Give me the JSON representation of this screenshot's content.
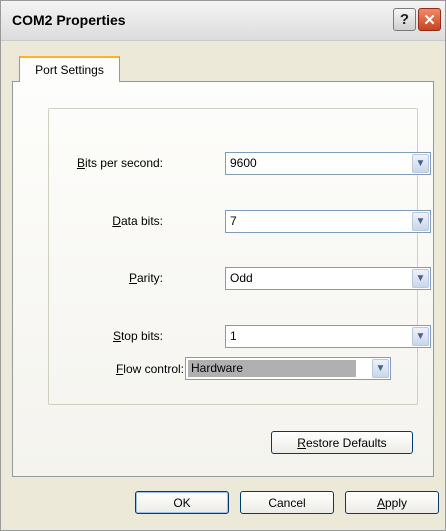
{
  "window": {
    "title": "COM2 Properties",
    "help_glyph": "?",
    "close_glyph": "✕"
  },
  "tabs": [
    {
      "label": "Port Settings",
      "active": true
    }
  ],
  "fields": [
    {
      "label_access": "B",
      "label_rest": "its per second:",
      "value": "9600"
    },
    {
      "label_access": "D",
      "label_rest": "ata bits:",
      "value": "7"
    },
    {
      "label_pre": "",
      "label_access": "P",
      "label_rest": "arity:",
      "value": "Odd"
    },
    {
      "label_access": "S",
      "label_rest": "top bits:",
      "value": "1"
    },
    {
      "label_access": "F",
      "label_rest": "low control:",
      "value": "Hardware"
    }
  ],
  "buttons": {
    "restore_access": "R",
    "restore_rest": "estore Defaults",
    "ok": "OK",
    "cancel": "Cancel",
    "apply_access": "A",
    "apply_rest": "pply"
  },
  "icons": {
    "dropdown": "chevron-down-icon"
  },
  "colors": {
    "accent_tab": "#ffb02f",
    "close_button": "#c9431e",
    "field_border": "#7f9db9"
  }
}
